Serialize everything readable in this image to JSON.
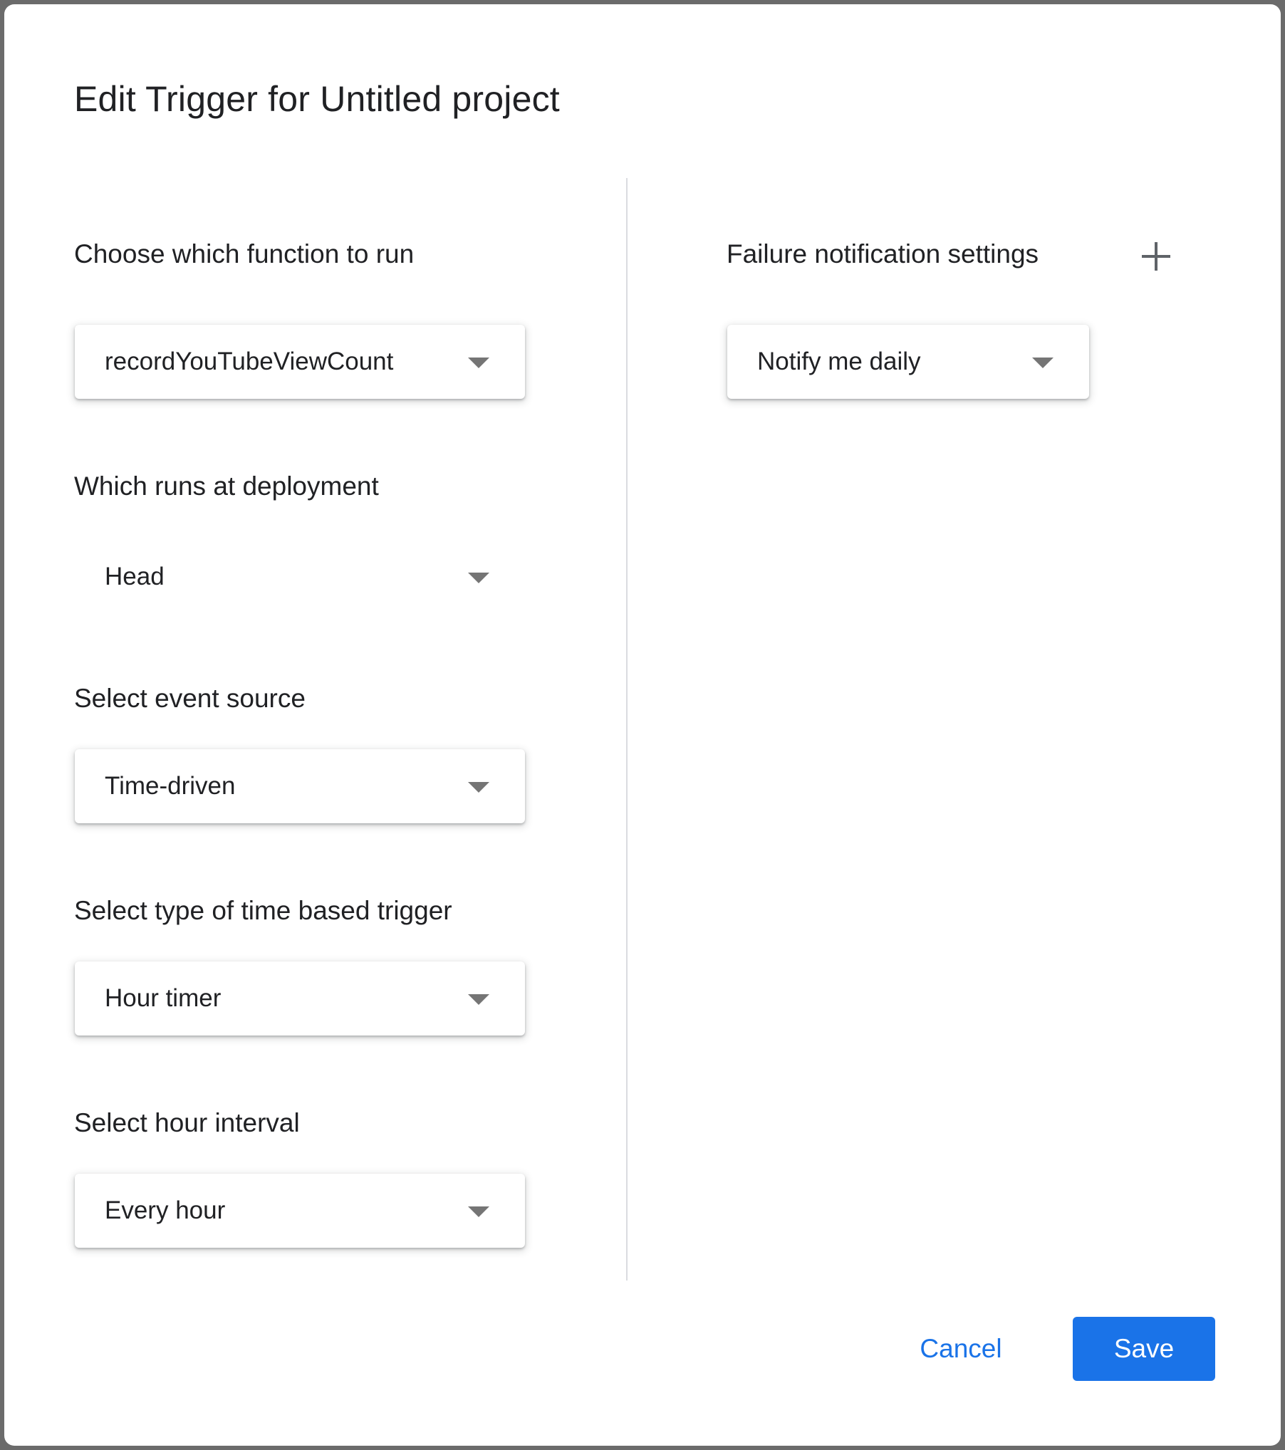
{
  "dialog": {
    "title": "Edit Trigger for Untitled project"
  },
  "left": {
    "function": {
      "label": "Choose which function to run",
      "value": "recordYouTubeViewCount"
    },
    "deployment": {
      "label": "Which runs at deployment",
      "value": "Head"
    },
    "event_source": {
      "label": "Select event source",
      "value": "Time-driven"
    },
    "trigger_type": {
      "label": "Select type of time based trigger",
      "value": "Hour timer"
    },
    "hour_interval": {
      "label": "Select hour interval",
      "value": "Every hour"
    }
  },
  "right": {
    "failure": {
      "label": "Failure notification settings",
      "value": "Notify me daily",
      "add_icon": "plus-icon"
    }
  },
  "footer": {
    "cancel_label": "Cancel",
    "save_label": "Save"
  },
  "colors": {
    "accent": "#1a73e8",
    "text": "#202124",
    "divider": "#dadce0",
    "icon": "#5f6368"
  }
}
